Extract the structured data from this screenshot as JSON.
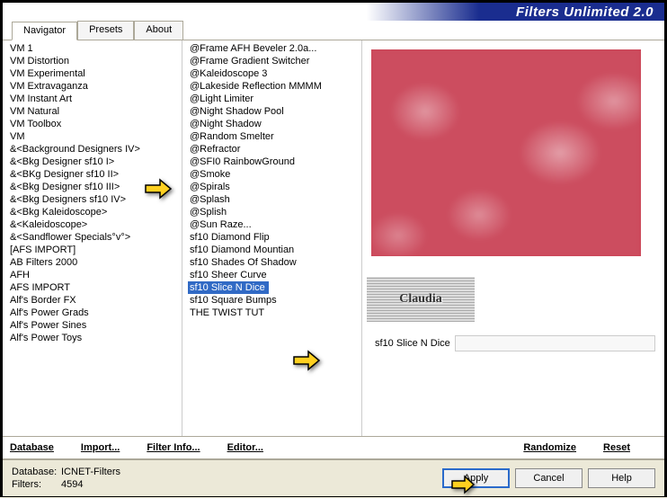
{
  "title": "Filters Unlimited 2.0",
  "tabs": [
    "Navigator",
    "Presets",
    "About"
  ],
  "active_tab": 0,
  "col1_items": [
    "VM 1",
    "VM Distortion",
    "VM Experimental",
    "VM Extravaganza",
    "VM Instant Art",
    "VM Natural",
    "VM Toolbox",
    "VM",
    "&<Background Designers IV>",
    "&<Bkg Designer sf10 I>",
    "&<BKg Designer sf10 II>",
    "&<Bkg Designer sf10 III>",
    "&<Bkg Designers sf10 IV>",
    "&<Bkg Kaleidoscope>",
    "&<Kaleidoscope>",
    "&<Sandflower Specials°v°>",
    "[AFS IMPORT]",
    "AB Filters 2000",
    "AFH",
    "AFS IMPORT",
    "Alf's Border FX",
    "Alf's Power Grads",
    "Alf's Power Sines",
    "Alf's Power Toys"
  ],
  "col2_items": [
    "@Frame AFH Beveler 2.0a...",
    "@Frame Gradient Switcher",
    "@Kaleidoscope 3",
    "@Lakeside Reflection MMMM",
    "@Light Limiter",
    "@Night Shadow Pool",
    "@Night Shadow",
    "@Random Smelter",
    "@Refractor",
    "@SFI0 RainbowGround",
    "@Smoke",
    "@Spirals",
    "@Splash",
    "@Splish",
    "@Sun Raze...",
    "sf10 Diamond Flip",
    "sf10 Diamond Mountian",
    "sf10 Shades Of Shadow",
    "sf10 Sheer Curve",
    "sf10 Slice N Dice",
    "sf10 Square Bumps",
    "THE TWIST TUT"
  ],
  "col2_selected": 19,
  "filter_name": "sf10 Slice N Dice",
  "button_row": {
    "database": "Database",
    "import": "Import...",
    "filter_info": "Filter Info...",
    "editor": "Editor...",
    "randomize": "Randomize",
    "reset": "Reset"
  },
  "status": {
    "db_label": "Database:",
    "db_value": "ICNET-Filters",
    "filters_label": "Filters:",
    "filters_value": "4594"
  },
  "buttons": {
    "apply": "Apply",
    "cancel": "Cancel",
    "help": "Help"
  },
  "watermark": "Claudia"
}
